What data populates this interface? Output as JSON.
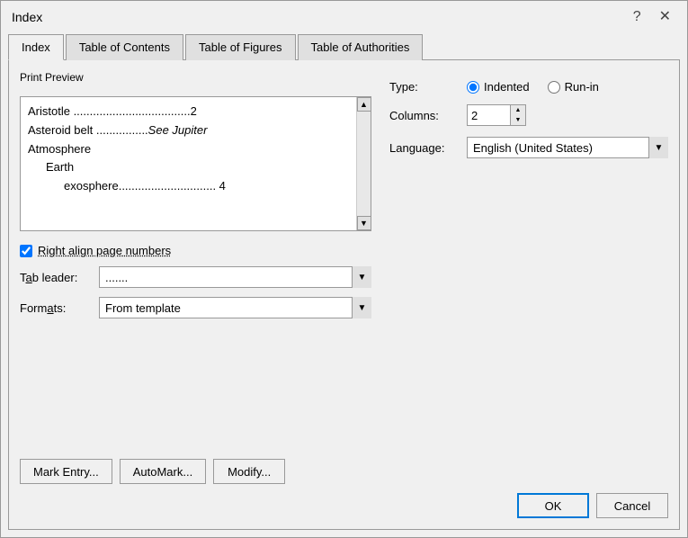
{
  "dialog": {
    "title": "Index",
    "help_label": "?",
    "close_label": "✕"
  },
  "tabs": [
    {
      "id": "index",
      "label": "Index",
      "active": true
    },
    {
      "id": "toc",
      "label": "Table of Contents",
      "active": false
    },
    {
      "id": "tof",
      "label": "Table of Figures",
      "active": false
    },
    {
      "id": "toa",
      "label": "Table of Authorities",
      "active": false
    }
  ],
  "preview": {
    "label": "Print Preview",
    "lines": [
      {
        "text": "Aristotle ....................................2",
        "indent": 0
      },
      {
        "text": "Asteroid belt ................See Jupiter",
        "indent": 0,
        "hasItalic": true,
        "italicPart": "See Jupiter"
      },
      {
        "text": "Atmosphere",
        "indent": 0
      },
      {
        "text": "Earth",
        "indent": 1
      },
      {
        "text": "exosphere.............................. 4",
        "indent": 2
      }
    ]
  },
  "options": {
    "right_align_label": "Right align page numbers",
    "right_align_checked": true,
    "tab_leader_label": "Tab leader:",
    "tab_leader_value": ".......",
    "formats_label": "Formats:",
    "formats_value": "From template"
  },
  "right_panel": {
    "type_label": "Type:",
    "indented_label": "Indented",
    "runin_label": "Run-in",
    "indented_selected": true,
    "columns_label": "Columns:",
    "columns_value": "2",
    "language_label": "Language:",
    "language_value": "English (United States)"
  },
  "buttons": {
    "mark_entry": "Mark Entry...",
    "auto_mark": "AutoMark...",
    "modify": "Modify...",
    "ok": "OK",
    "cancel": "Cancel"
  }
}
